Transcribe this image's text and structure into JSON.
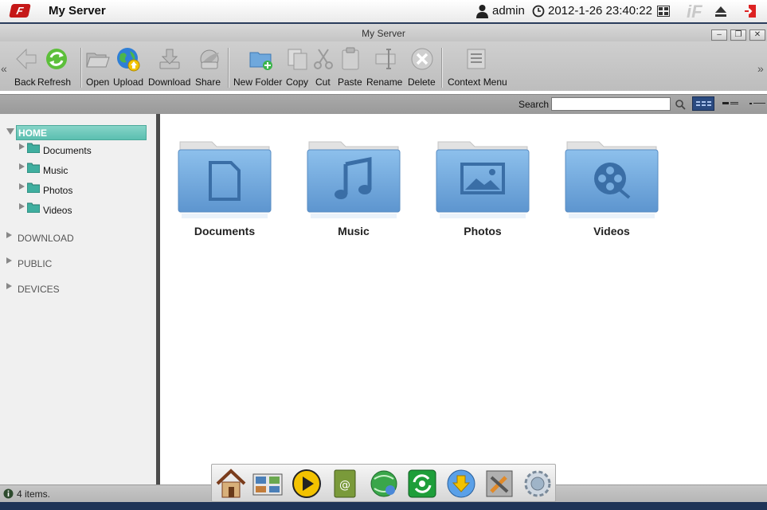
{
  "topbar": {
    "app_title": "My Server",
    "user": "admin",
    "datetime": "2012-1-26 23:40:22"
  },
  "window": {
    "title": "My Server",
    "buttons": [
      "minimize",
      "maximize",
      "close"
    ]
  },
  "toolbar": {
    "items": [
      {
        "label": "Back",
        "icon": "back-arrow-icon"
      },
      {
        "label": "Refresh",
        "icon": "refresh-icon"
      },
      {
        "label": "Open",
        "icon": "open-folder-icon"
      },
      {
        "label": "Upload",
        "icon": "upload-globe-icon"
      },
      {
        "label": "Download",
        "icon": "download-icon"
      },
      {
        "label": "Share",
        "icon": "share-icon"
      },
      {
        "label": "New Folder",
        "icon": "new-folder-icon"
      },
      {
        "label": "Copy",
        "icon": "copy-icon"
      },
      {
        "label": "Cut",
        "icon": "scissors-icon"
      },
      {
        "label": "Paste",
        "icon": "clipboard-icon"
      },
      {
        "label": "Rename",
        "icon": "rename-icon"
      },
      {
        "label": "Delete",
        "icon": "delete-icon"
      },
      {
        "label": "Context Menu",
        "icon": "context-menu-icon"
      }
    ]
  },
  "search": {
    "label": "Search",
    "value": "",
    "placeholder": ""
  },
  "sidebar": {
    "home": {
      "label": "HOME",
      "children": [
        "Documents",
        "Music",
        "Photos",
        "Videos"
      ]
    },
    "roots": [
      "DOWNLOAD",
      "PUBLIC",
      "DEVICES"
    ]
  },
  "content": {
    "folders": [
      {
        "name": "Documents",
        "icon": "document-icon"
      },
      {
        "name": "Music",
        "icon": "music-note-icon"
      },
      {
        "name": "Photos",
        "icon": "picture-icon"
      },
      {
        "name": "Videos",
        "icon": "film-reel-icon"
      }
    ]
  },
  "statusbar": {
    "text": "4 items."
  },
  "dock": {
    "items": [
      "home-app-icon",
      "photo-album-app-icon",
      "media-player-app-icon",
      "address-book-app-icon",
      "network-app-icon",
      "sync-app-icon",
      "download-manager-app-icon",
      "tools-app-icon",
      "settings-app-icon"
    ]
  },
  "colors": {
    "accent_selection": "#5bbfb0",
    "folder_blue": "#6fa8dc",
    "dark_navy": "#1f3457"
  }
}
